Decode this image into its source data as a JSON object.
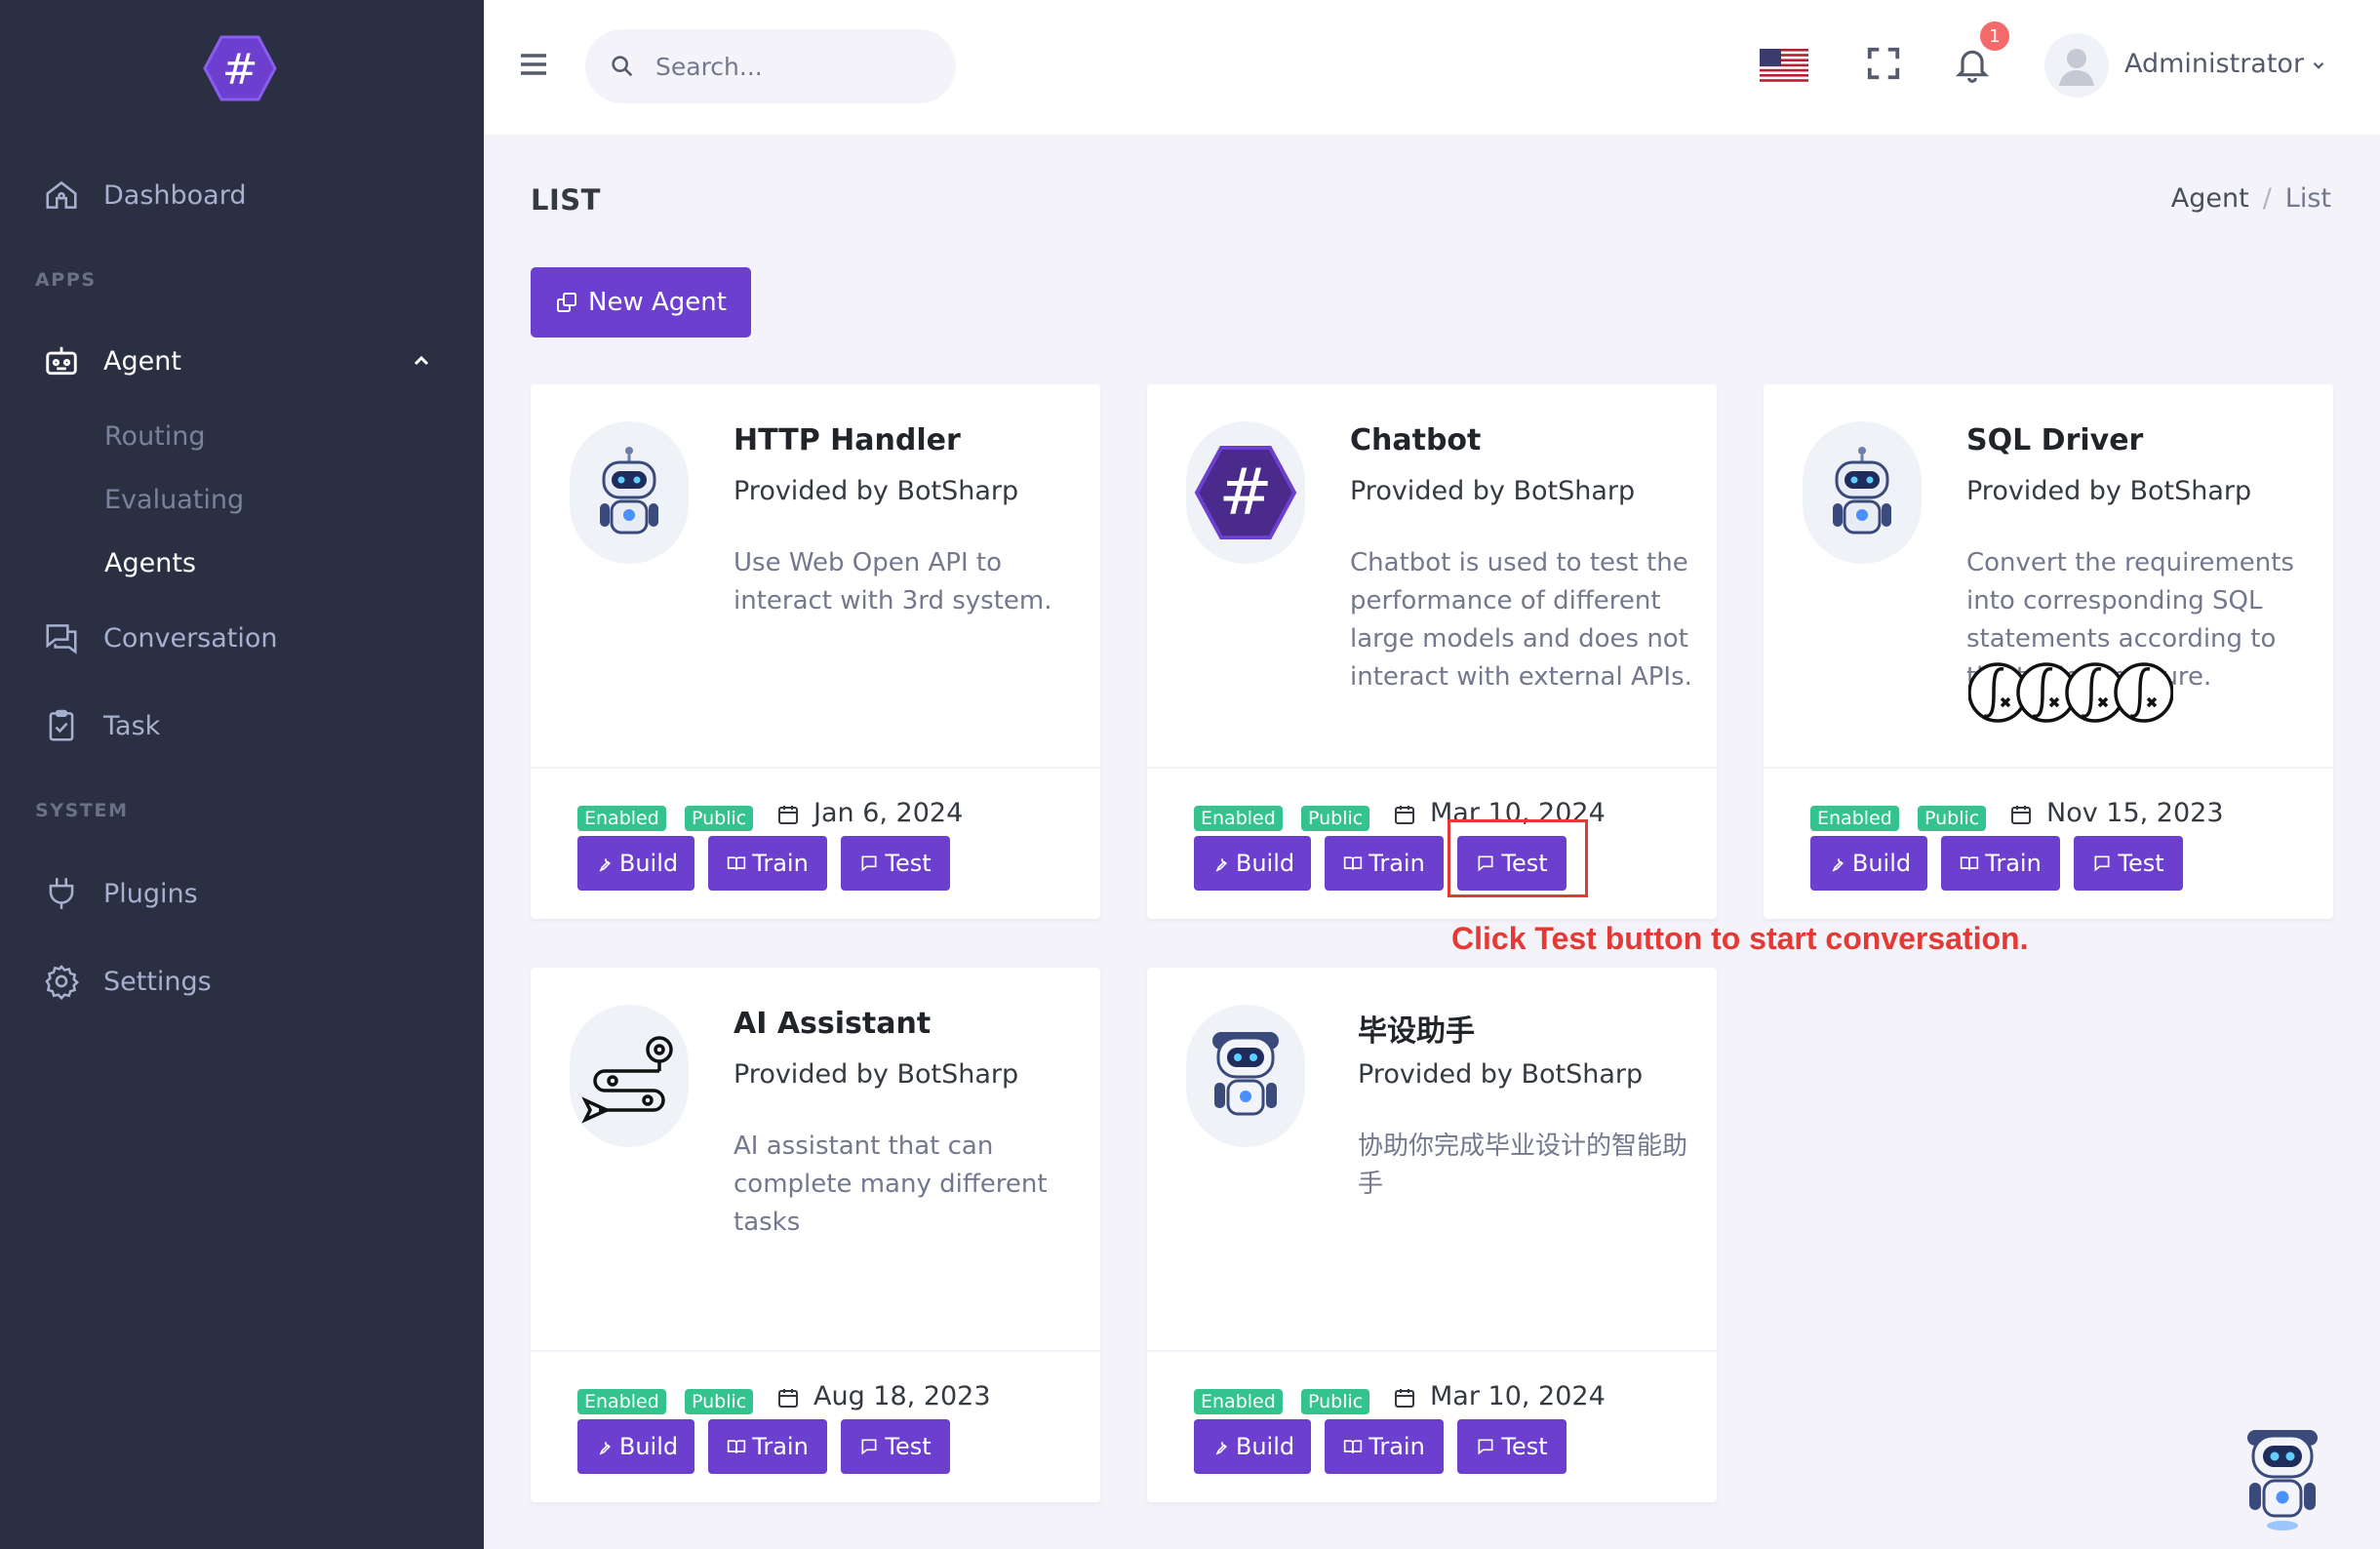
{
  "sidebar": {
    "dashboard": "Dashboard",
    "apps_title": "APPS",
    "agent": "Agent",
    "sub": [
      "Routing",
      "Evaluating",
      "Agents"
    ],
    "conversation": "Conversation",
    "task": "Task",
    "system_title": "SYSTEM",
    "plugins": "Plugins",
    "settings": "Settings"
  },
  "topbar": {
    "search_placeholder": "Search...",
    "notification_count": "1",
    "user_name": "Administrator"
  },
  "page": {
    "title": "LIST",
    "breadcrumb": [
      "Agent",
      "List"
    ],
    "new_agent": "New Agent"
  },
  "labels": {
    "enabled": "Enabled",
    "public": "Public",
    "build": "Build",
    "train": "Train",
    "test": "Test"
  },
  "agents": [
    {
      "name": "HTTP Handler",
      "provider": "Provided by BotSharp",
      "description": "Use Web Open API to interact with 3rd system.",
      "date": "Jan 6, 2024"
    },
    {
      "name": "Chatbot",
      "provider": "Provided by BotSharp",
      "description": "Chatbot is used to test the performance of different large models and does not interact with external APIs.",
      "date": "Mar 10, 2024"
    },
    {
      "name": "SQL Driver",
      "provider": "Provided by BotSharp",
      "description": "Convert the requirements into corresponding SQL statements according to the table structure.",
      "date": "Nov 15, 2023"
    },
    {
      "name": "AI Assistant",
      "provider": "Provided by BotSharp",
      "description": "AI assistant that can complete many different tasks",
      "date": "Aug 18, 2023"
    },
    {
      "name": "毕设助手",
      "provider": "Provided by BotSharp",
      "description": "协助你完成毕业设计的智能助手",
      "date": "Mar 10, 2024"
    }
  ],
  "annotation": "Click Test button to start conversation.",
  "colors": {
    "sidebar": "#2a3042",
    "primary": "#6c3fcf",
    "success": "#34c38f",
    "danger": "#f46a6a",
    "annotation": "#e53935"
  }
}
